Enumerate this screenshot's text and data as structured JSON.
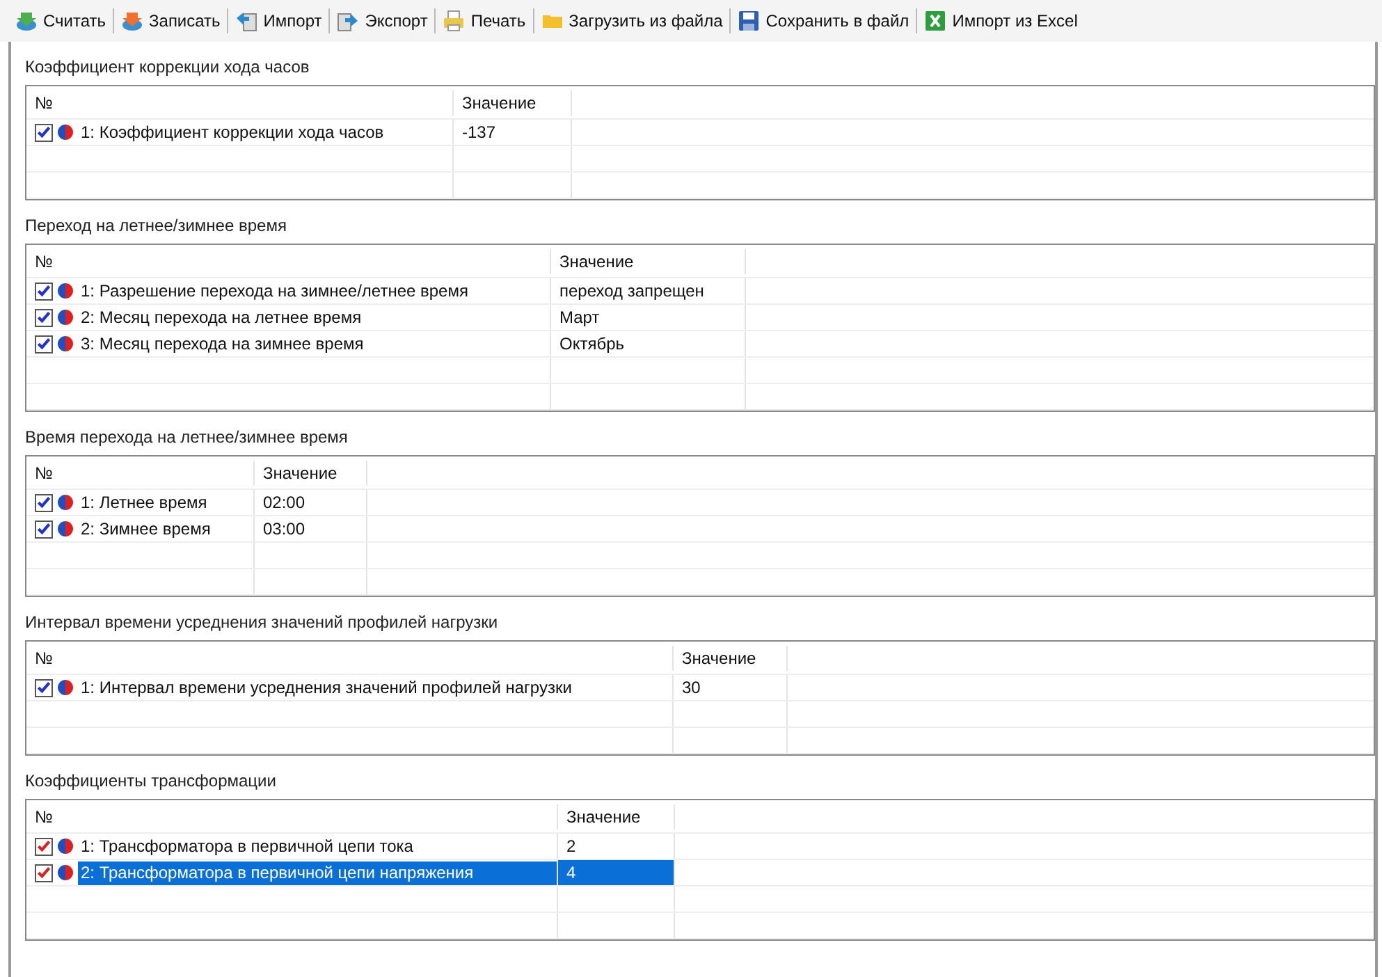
{
  "toolbar": [
    {
      "label": "Считать",
      "kind": "read"
    },
    {
      "label": "Записать",
      "kind": "write"
    },
    {
      "label": "Импорт",
      "kind": "import"
    },
    {
      "label": "Экспорт",
      "kind": "export"
    },
    {
      "label": "Печать",
      "kind": "print"
    },
    {
      "label": "Загрузить из файла",
      "kind": "folder"
    },
    {
      "label": "Сохранить в файл",
      "kind": "save"
    },
    {
      "label": "Импорт из Excel",
      "kind": "excel"
    }
  ],
  "groups": [
    {
      "title": "Коэффициент коррекции хода часов",
      "columns": [
        "№",
        "Значение"
      ],
      "rows": [
        {
          "name": "1: Коэффициент коррекции хода часов",
          "value": "-137",
          "checked": true,
          "color": "#2233cc",
          "selected": false
        }
      ]
    },
    {
      "title": "Переход на летнее/зимнее время",
      "columns": [
        "№",
        "Значение"
      ],
      "rows": [
        {
          "name": "1: Разрешение перехода на зимнее/летнее время",
          "value": "переход запрещен",
          "checked": true,
          "color": "#2233cc",
          "selected": false
        },
        {
          "name": "2: Месяц перехода на летнее время",
          "value": "Март",
          "checked": true,
          "color": "#2233cc",
          "selected": false
        },
        {
          "name": "3: Месяц перехода на зимнее время",
          "value": "Октябрь",
          "checked": true,
          "color": "#2233cc",
          "selected": false
        }
      ]
    },
    {
      "title": "Время перехода на летнее/зимнее время",
      "columns": [
        "№",
        "Значение"
      ],
      "rows": [
        {
          "name": "1: Летнее время",
          "value": "02:00",
          "checked": true,
          "color": "#2233cc",
          "selected": false
        },
        {
          "name": "2: Зимнее время",
          "value": "03:00",
          "checked": true,
          "color": "#2233cc",
          "selected": false
        }
      ]
    },
    {
      "title": "Интервал времени усреднения значений профилей нагрузки",
      "columns": [
        "№",
        "Значение"
      ],
      "rows": [
        {
          "name": "1: Интервал времени усреднения значений профилей нагрузки",
          "value": "30",
          "checked": true,
          "color": "#2233cc",
          "selected": false
        }
      ]
    },
    {
      "title": "Коэффициенты трансформации",
      "columns": [
        "№",
        "Значение"
      ],
      "rows": [
        {
          "name": "1: Трансформатора в первичной цепи тока",
          "value": "2",
          "checked": true,
          "color": "#dd2222",
          "selected": false
        },
        {
          "name": "2: Трансформатора в первичной цепи напряжения",
          "value": "4",
          "checked": true,
          "color": "#dd2222",
          "selected": true
        }
      ]
    }
  ]
}
